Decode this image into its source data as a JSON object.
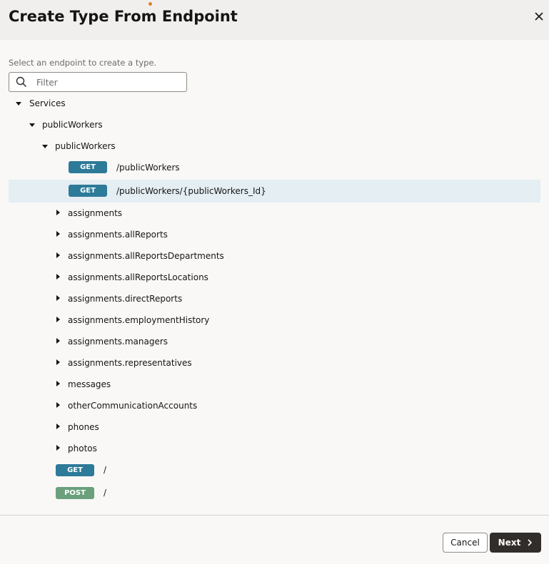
{
  "dialog": {
    "title": "Create Type From Endpoint",
    "instruction": "Select an endpoint to create a type.",
    "filter_placeholder": "Filter"
  },
  "tree": {
    "root": "Services",
    "service": "publicWorkers",
    "group": "publicWorkers",
    "endpoints": [
      {
        "method": "GET",
        "path": "/publicWorkers"
      },
      {
        "method": "GET",
        "path": "/publicWorkers/{publicWorkers_Id}",
        "selected": true
      }
    ],
    "children": [
      "assignments",
      "assignments.allReports",
      "assignments.allReportsDepartments",
      "assignments.allReportsLocations",
      "assignments.directReports",
      "assignments.employmentHistory",
      "assignments.managers",
      "assignments.representatives",
      "messages",
      "otherCommunicationAccounts",
      "phones",
      "photos"
    ],
    "service_endpoints": [
      {
        "method": "GET",
        "path": "/"
      },
      {
        "method": "POST",
        "path": "/"
      }
    ]
  },
  "footer": {
    "cancel_label": "Cancel",
    "next_label": "Next"
  },
  "colors": {
    "get_badge": "#2d7a99",
    "post_badge": "#6aa07c",
    "selected_row": "#e4eef3",
    "primary_button": "#312d2a"
  }
}
